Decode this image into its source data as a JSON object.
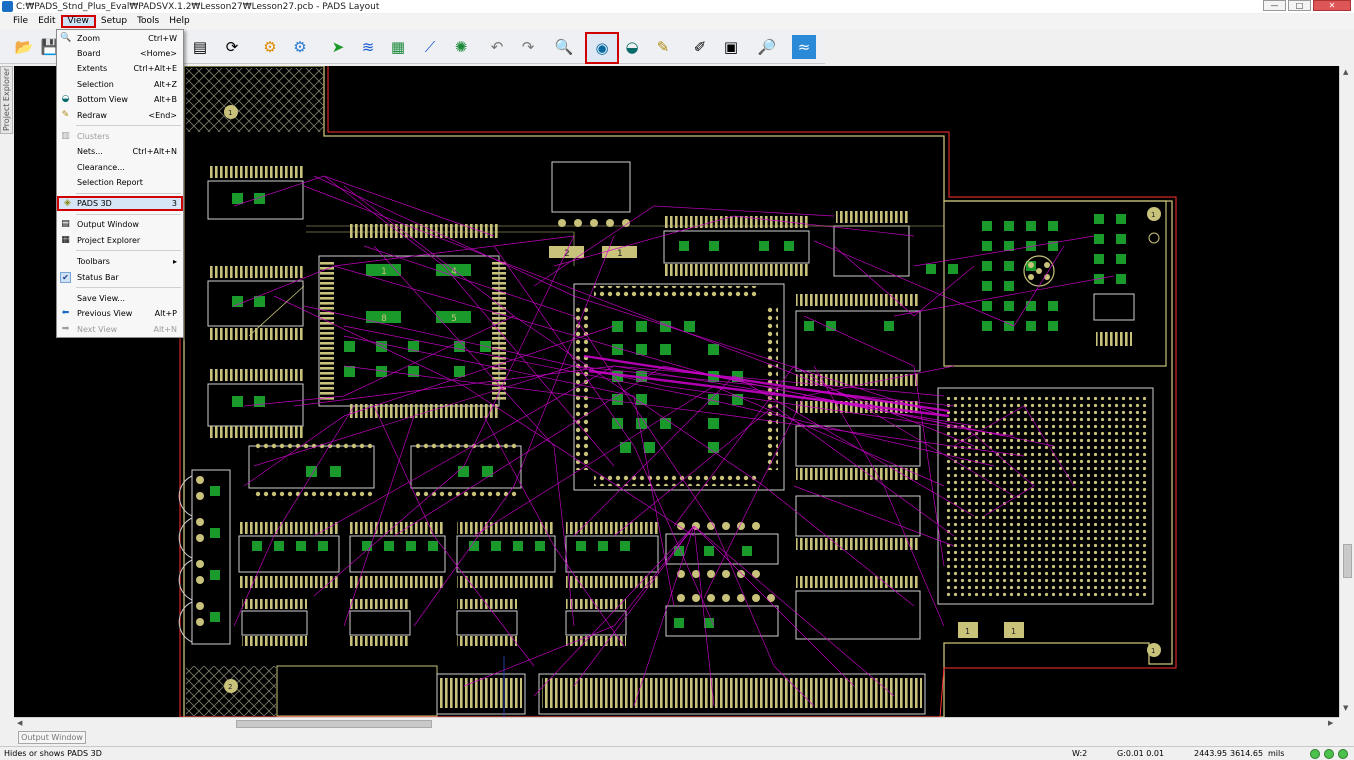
{
  "window": {
    "title": "C:₩PADS_Stnd_Plus_Eval₩PADSVX.1.2₩Lesson27₩Lesson27.pcb - PADS Layout",
    "icon": "pads-app-icon",
    "controls": {
      "minimize": "—",
      "maximize": "□",
      "close": "✕"
    }
  },
  "menubar": [
    {
      "label": "File"
    },
    {
      "label": "Edit"
    },
    {
      "label": "View",
      "active": true
    },
    {
      "label": "Setup"
    },
    {
      "label": "Tools"
    },
    {
      "label": "Help"
    }
  ],
  "toolbar": [
    {
      "icon": "open-folder-icon",
      "glyph": "📂"
    },
    {
      "icon": "save-disk-icon",
      "glyph": "💾"
    },
    {
      "icon": "properties-icon",
      "glyph": "▤"
    },
    {
      "icon": "refresh-icon",
      "glyph": "⟳"
    },
    {
      "icon": "settings-gear-orange-icon",
      "glyph": "⚙"
    },
    {
      "icon": "settings-gear-blue-icon",
      "glyph": "⚙"
    },
    {
      "icon": "move-component-icon",
      "glyph": "➤"
    },
    {
      "icon": "route-traces-icon",
      "glyph": "≋"
    },
    {
      "icon": "pcb-board-icon",
      "glyph": "▦"
    },
    {
      "icon": "add-trace-icon",
      "glyph": "⟋"
    },
    {
      "icon": "via-icon",
      "glyph": "✺"
    },
    {
      "icon": "undo-icon",
      "glyph": "↶"
    },
    {
      "icon": "redo-icon",
      "glyph": "↷"
    },
    {
      "icon": "zoom-icon",
      "glyph": "🔍"
    },
    {
      "icon": "pads-3d-icon",
      "glyph": "◉",
      "highlighted": true
    },
    {
      "icon": "bottom-view-icon",
      "glyph": "◒"
    },
    {
      "icon": "redraw-brush-icon",
      "glyph": "✎"
    },
    {
      "icon": "drafting-icon",
      "glyph": "✐"
    },
    {
      "icon": "library-icon",
      "glyph": "▣"
    },
    {
      "icon": "verify-design-icon",
      "glyph": "🔎"
    },
    {
      "icon": "router-link-icon",
      "glyph": "≈"
    }
  ],
  "side_tab": {
    "label": "Project Explorer"
  },
  "view_menu": {
    "items": [
      {
        "label": "Zoom",
        "shortcut": "Ctrl+W",
        "icon": "zoom-icon",
        "glyph": "🔍"
      },
      {
        "label": "Board",
        "shortcut": "<Home>"
      },
      {
        "label": "Extents",
        "shortcut": "Ctrl+Alt+E"
      },
      {
        "label": "Selection",
        "shortcut": "Alt+Z"
      },
      {
        "label": "Bottom View",
        "shortcut": "Alt+B",
        "icon": "bottom-view-icon",
        "glyph": "◒"
      },
      {
        "label": "Redraw",
        "shortcut": "<End>",
        "icon": "redraw-brush-icon",
        "glyph": "✎"
      },
      {
        "separator": true
      },
      {
        "label": "Clusters",
        "shortcut": "",
        "disabled": true,
        "icon": "clusters-icon",
        "glyph": "▥"
      },
      {
        "label": "Nets...",
        "shortcut": "Ctrl+Alt+N"
      },
      {
        "label": "Clearance...",
        "shortcut": ""
      },
      {
        "label": "Selection Report",
        "shortcut": ""
      },
      {
        "separator": true
      },
      {
        "label": "PADS 3D",
        "shortcut": "3",
        "highlighted": true,
        "icon": "pads-3d-icon",
        "glyph": "◈"
      },
      {
        "separator": true
      },
      {
        "label": "Output Window",
        "shortcut": "",
        "icon": "output-window-icon",
        "glyph": "▤"
      },
      {
        "label": "Project Explorer",
        "shortcut": "",
        "icon": "project-explorer-icon",
        "glyph": "▦"
      },
      {
        "separator": true
      },
      {
        "label": "Toolbars",
        "shortcut": "▸"
      },
      {
        "label": "Status Bar",
        "shortcut": "",
        "checked": true,
        "icon": "check-icon",
        "glyph": "✔"
      },
      {
        "separator": true
      },
      {
        "label": "Save View...",
        "shortcut": ""
      },
      {
        "label": "Previous View",
        "shortcut": "Alt+P",
        "icon": "previous-view-icon",
        "glyph": "⬅"
      },
      {
        "label": "Next View",
        "shortcut": "Alt+N",
        "disabled": true,
        "icon": "next-view-icon",
        "glyph": "➡"
      }
    ]
  },
  "pcb": {
    "labels": [
      "1",
      "4",
      "8",
      "5",
      "2",
      "1",
      "1",
      "2",
      "1",
      "1",
      "1",
      "1"
    ],
    "colors": {
      "background": "#000000",
      "pads": "#c9c27a",
      "components": "#1a9a2a",
      "ratsnest": "#d000d0",
      "outline": "#d0d0d0",
      "board_edge": "#ff3030",
      "keepout": "#c9c27a"
    }
  },
  "output_tab": {
    "label": "Output Window"
  },
  "status": {
    "hint": "Hides or shows PADS 3D",
    "width": "W:2",
    "grid": "G:0.01 0.01",
    "x": "2443.95",
    "y": "3614.65",
    "units": "mils"
  }
}
